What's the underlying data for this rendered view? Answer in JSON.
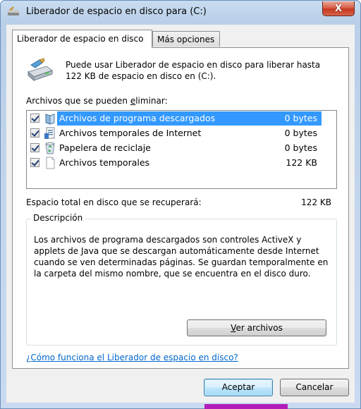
{
  "window": {
    "title": "Liberador de espacio en disco para  (C:)",
    "close_symbol": "X"
  },
  "tabs": [
    {
      "label": "Liberador de espacio en disco",
      "active": true
    },
    {
      "label": "Más opciones",
      "active": false
    }
  ],
  "intro": "Puede usar Liberador de espacio en disco para liberar hasta 122 KB de espacio en disco en  (C:).",
  "files_label": {
    "before": "Archivos que se pueden ",
    "accel": "e",
    "after": "liminar:"
  },
  "files": [
    {
      "name": "Archivos de programa descargados",
      "size": "0 bytes",
      "checked": true,
      "selected": true,
      "icon": "folder-icon"
    },
    {
      "name": "Archivos temporales de Internet",
      "size": "0 bytes",
      "checked": true,
      "selected": false,
      "icon": "document-icon"
    },
    {
      "name": "Papelera de reciclaje",
      "size": "0 bytes",
      "checked": true,
      "selected": false,
      "icon": "recycle-bin-icon"
    },
    {
      "name": "Archivos temporales",
      "size": "122 KB",
      "checked": true,
      "selected": false,
      "icon": "blank-page-icon"
    }
  ],
  "total": {
    "label": "Espacio total en disco que se recuperará:",
    "value": "122 KB"
  },
  "description": {
    "title": "Descripción",
    "text": "Los archivos de programa descargados son controles ActiveX y applets de Java que se descargan automáticamente desde Internet cuando se ven determinadas páginas. Se guardan temporalmente en la carpeta del mismo nombre, que se encuentra en el disco duro."
  },
  "view_button": {
    "accel": "V",
    "rest": "er archivos"
  },
  "help_link": "¿Cómo funciona el Liberador de espacio en disco?",
  "buttons": {
    "ok": "Aceptar",
    "cancel": "Cancelar"
  },
  "colors": {
    "selection": "#3399ff",
    "link": "#0066cc",
    "close": "#c7381f"
  }
}
